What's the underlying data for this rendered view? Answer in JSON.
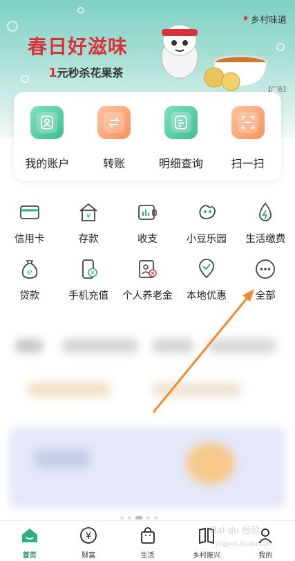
{
  "banner": {
    "brand": "乡村味道",
    "headline": "春日好滋味",
    "sub_prefix": "1",
    "sub_rest": "元秒杀花果茶",
    "ad_tag": "【广告】"
  },
  "quick": [
    {
      "label": "我的账户",
      "icon": "account-icon",
      "color": "green"
    },
    {
      "label": "转账",
      "icon": "transfer-icon",
      "color": "orange"
    },
    {
      "label": "明细查询",
      "icon": "details-icon",
      "color": "green"
    },
    {
      "label": "扫一扫",
      "icon": "scan-icon",
      "color": "orange"
    }
  ],
  "grid": [
    {
      "label": "信用卡",
      "icon": "credit-card-icon"
    },
    {
      "label": "存款",
      "icon": "deposit-icon"
    },
    {
      "label": "收支",
      "icon": "income-expense-icon"
    },
    {
      "label": "小豆乐园",
      "icon": "bean-park-icon"
    },
    {
      "label": "生活缴费",
      "icon": "utility-payment-icon"
    },
    {
      "label": "贷款",
      "icon": "loan-icon"
    },
    {
      "label": "手机充值",
      "icon": "phone-recharge-icon"
    },
    {
      "label": "个人养老金",
      "icon": "pension-icon"
    },
    {
      "label": "本地优惠",
      "icon": "local-deals-icon"
    },
    {
      "label": "全部",
      "icon": "more-icon"
    }
  ],
  "nav": [
    {
      "label": "首页",
      "icon": "home-icon",
      "active": true
    },
    {
      "label": "财富",
      "icon": "wealth-icon",
      "active": false
    },
    {
      "label": "生活",
      "icon": "life-icon",
      "active": false
    },
    {
      "label": "乡村振兴",
      "icon": "rural-icon",
      "active": false
    },
    {
      "label": "我的",
      "icon": "profile-icon",
      "active": false
    }
  ],
  "watermark": {
    "text": "Bai du 经验",
    "url": "jingyan.baidu.com"
  },
  "colors": {
    "accent": "#1d8f6e",
    "arrow": "#f08a2c",
    "brand_red": "#d8323a"
  }
}
